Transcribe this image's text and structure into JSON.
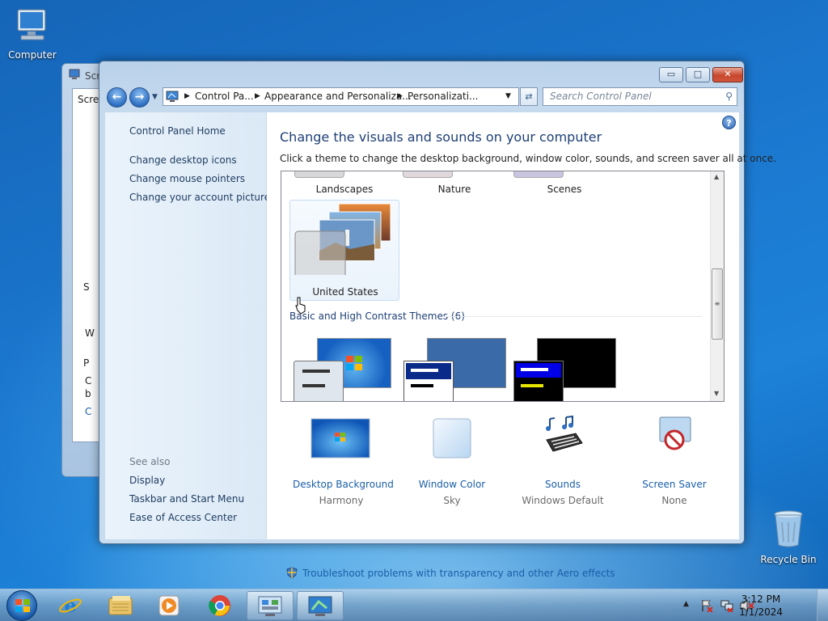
{
  "desktop": {
    "icons": [
      {
        "label": "Computer"
      },
      {
        "label": "Recycle Bin"
      }
    ]
  },
  "back_window": {
    "title": "Scr",
    "tab": "Scree",
    "frag1": "S",
    "frag2": "W",
    "frag3": "P",
    "frag4": "C",
    "frag5": "b",
    "frag6": "C"
  },
  "window": {
    "buttons": {
      "minimize": "▭",
      "maximize": "□",
      "close": "✕"
    },
    "address": {
      "segments": [
        "Control Pa...",
        "Appearance and Personaliza...",
        "Personalizati..."
      ]
    },
    "search_placeholder": "Search Control Panel",
    "left": {
      "home": "Control Panel Home",
      "links": [
        "Change desktop icons",
        "Change mouse pointers",
        "Change your account picture"
      ],
      "see_also_title": "See also",
      "see_also": [
        "Display",
        "Taskbar and Start Menu",
        "Ease of Access Center"
      ]
    },
    "heading": "Change the visuals and sounds on your computer",
    "subtitle": "Click a theme to change the desktop background, window color, sounds, and screen saver all at once.",
    "themes": {
      "top_row": [
        "Landscapes",
        "Nature",
        "Scenes"
      ],
      "selected_theme": "United States",
      "basic_group": "Basic and High Contrast Themes (6)"
    },
    "bottom_items": [
      {
        "name": "Desktop Background",
        "value": "Harmony"
      },
      {
        "name": "Window Color",
        "value": "Sky"
      },
      {
        "name": "Sounds",
        "value": "Windows Default"
      },
      {
        "name": "Screen Saver",
        "value": "None"
      }
    ],
    "troubleshoot": "Troubleshoot problems with transparency and other Aero effects"
  },
  "taskbar": {
    "time": "3:12 PM",
    "date": "1/1/2024"
  },
  "colors": {
    "link": "#1a5fa8",
    "heading": "#1e3f75"
  }
}
